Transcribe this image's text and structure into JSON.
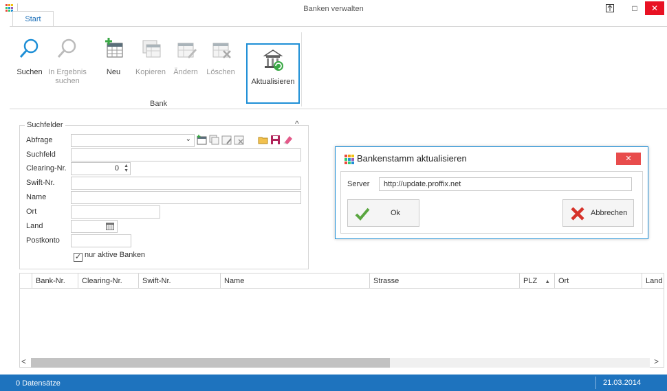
{
  "window": {
    "title": "Banken verwalten",
    "pin_symbol": "⊼",
    "maximize_symbol": "□",
    "close_symbol": "✕"
  },
  "ribbon": {
    "tab": "Start",
    "collapse_symbol": "^",
    "buttons": {
      "suchen": "Suchen",
      "in_ergebnis_suchen_1": "In Ergebnis",
      "in_ergebnis_suchen_2": "suchen",
      "neu": "Neu",
      "kopieren": "Kopieren",
      "aendern": "Ändern",
      "loeschen": "Löschen",
      "aktualisieren": "Aktualisieren"
    },
    "group_label": "Bank"
  },
  "suchfelder": {
    "title": "Suchfelder",
    "collapse_symbol": "^",
    "labels": {
      "abfrage": "Abfrage",
      "suchfeld": "Suchfeld",
      "clearing": "Clearing-Nr.",
      "swift": "Swift-Nr.",
      "name": "Name",
      "ort": "Ort",
      "land": "Land",
      "postkonto": "Postkonto"
    },
    "clearing_value": "0",
    "nur_aktive_label": "nur aktive Banken",
    "nur_aktive_checked": true
  },
  "grid": {
    "columns": [
      "Bank-Nr.",
      "Clearing-Nr.",
      "Swift-Nr.",
      "Name",
      "Strasse",
      "PLZ",
      "Ort",
      "Land"
    ],
    "sort_column": "PLZ",
    "sort_symbol": "▲",
    "scroll_left": "<",
    "scroll_right": ">"
  },
  "statusbar": {
    "count": "0 Datensätze",
    "date": "21.03.2014"
  },
  "dialog": {
    "title": "Bankenstamm aktualisieren",
    "close_symbol": "✕",
    "server_label": "Server",
    "server_value": "http://update.proffix.net",
    "ok_label": "Ok",
    "cancel_label": "Abbrechen"
  },
  "colors": {
    "accent": "#1e8fd6",
    "status_bar": "#1e73be",
    "close_red": "#e81123",
    "ok_green": "#5aa640",
    "cancel_red": "#d6322a",
    "logo": [
      "#e84c3d",
      "#f39c12",
      "#f1c40f",
      "#2ecc71",
      "#1e8fd6",
      "#9b59b6",
      "#e84c3d",
      "#2ecc71",
      "#1e8fd6"
    ]
  },
  "icons": [
    "app-logo-icon",
    "search-icon",
    "search-in-results-icon",
    "new-table-icon",
    "copy-table-icon",
    "edit-table-icon",
    "delete-table-icon",
    "bank-refresh-icon",
    "calendar-icon",
    "checkmark-icon",
    "cross-icon"
  ]
}
